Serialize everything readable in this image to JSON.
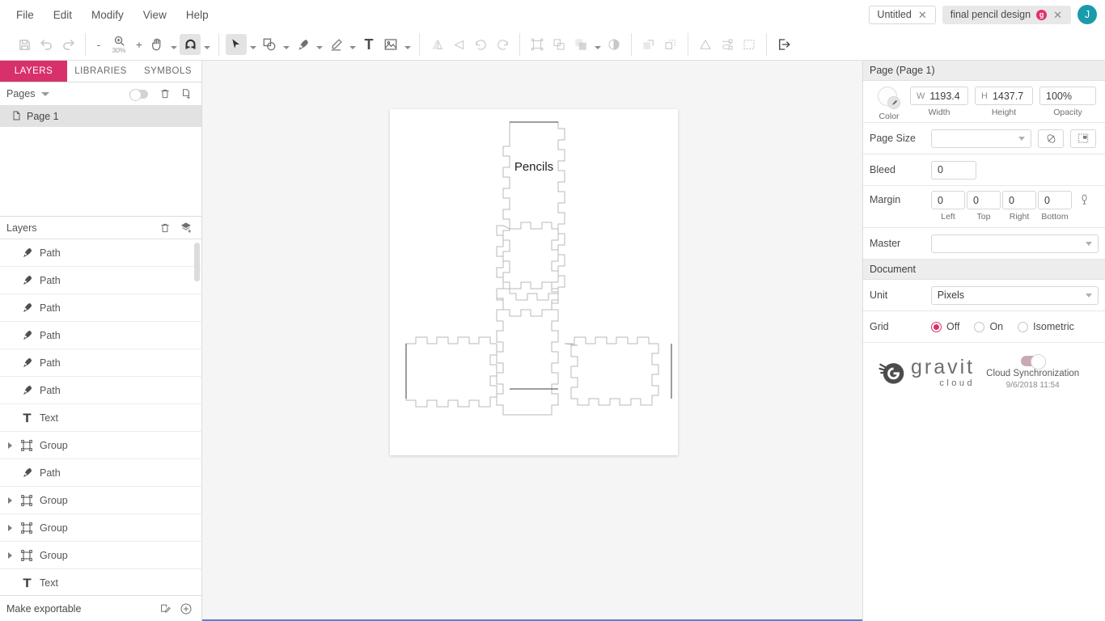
{
  "menubar": {
    "items": [
      "File",
      "Edit",
      "Modify",
      "View",
      "Help"
    ],
    "tabs": [
      {
        "title": "Untitled",
        "close": "✕",
        "badge": null,
        "active": false
      },
      {
        "title": "final pencil design",
        "close": "✕",
        "badge": "g",
        "active": true
      }
    ],
    "avatar_initial": "J"
  },
  "toolbar": {
    "zoom_minus": "-",
    "zoom_level": "30%",
    "zoom_plus": "+",
    "tools": {
      "save": "save-icon",
      "undo": "undo-icon",
      "redo": "redo-icon",
      "zoom": "zoom-icon",
      "hand": "hand-icon",
      "snap": "magnet-icon",
      "pointer": "pointer-icon",
      "shape": "shape-icon",
      "pen": "pen-icon",
      "pencil": "pencil-icon",
      "text": "T",
      "image": "image-icon",
      "flip_h": "flip-horizontal-icon",
      "flip_v": "flip-vertical-icon",
      "rotate_ccw": "rotate-ccw-icon",
      "rotate_cw": "rotate-cw-icon",
      "group": "group-icon",
      "ungroup": "ungroup-icon",
      "boolean": "boolean-icon",
      "mask": "mask-icon",
      "bring_forward": "bring-forward-icon",
      "send_backward": "send-backward-icon",
      "convert_path": "convert-to-path-icon",
      "path_ops": "path-ops-icon",
      "slice": "slice-icon",
      "export": "export-icon"
    }
  },
  "left_panel": {
    "tabs": [
      {
        "label": "LAYERS",
        "active": true
      },
      {
        "label": "LIBRARIES",
        "active": false
      },
      {
        "label": "SYMBOLS",
        "active": false
      }
    ],
    "pages_section": {
      "title": "Pages",
      "delete_icon": "trash-icon",
      "add_icon": "add-page-icon",
      "pages": [
        {
          "name": "Page 1",
          "selected": true
        }
      ]
    },
    "layers_section": {
      "title": "Layers",
      "delete_icon": "trash-icon",
      "add_icon": "add-layer-icon",
      "items": [
        {
          "label": "Path",
          "type": "path",
          "expandable": false
        },
        {
          "label": "Path",
          "type": "path",
          "expandable": false
        },
        {
          "label": "Path",
          "type": "path",
          "expandable": false
        },
        {
          "label": "Path",
          "type": "path",
          "expandable": false
        },
        {
          "label": "Path",
          "type": "path",
          "expandable": false
        },
        {
          "label": "Path",
          "type": "path",
          "expandable": false
        },
        {
          "label": "Text",
          "type": "text",
          "expandable": false
        },
        {
          "label": "Group",
          "type": "group",
          "expandable": true
        },
        {
          "label": "Path",
          "type": "path",
          "expandable": false
        },
        {
          "label": "Group",
          "type": "group",
          "expandable": true
        },
        {
          "label": "Group",
          "type": "group",
          "expandable": true
        },
        {
          "label": "Group",
          "type": "group",
          "expandable": true
        },
        {
          "label": "Text",
          "type": "text",
          "expandable": false
        }
      ]
    },
    "footer": {
      "label": "Make exportable",
      "edit_icon": "export-edit-icon",
      "add_icon": "plus-circle-icon"
    }
  },
  "canvas": {
    "artwork_label": "Pencils",
    "page_background": "#ffffff",
    "area_background": "#f5f5f5"
  },
  "right_panel": {
    "header": "Page (Page 1)",
    "color_label": "Color",
    "width": {
      "unit": "W",
      "value": "1193.4",
      "label": "Width"
    },
    "height": {
      "unit": "H",
      "value": "1437.7",
      "label": "Height"
    },
    "opacity": {
      "value": "100%",
      "label": "Opacity"
    },
    "page_size": {
      "label": "Page Size",
      "value": "",
      "orientation_icon": "orientation-icon",
      "fit_icon": "fit-to-selection-icon"
    },
    "bleed": {
      "label": "Bleed",
      "value": "0"
    },
    "margin": {
      "label": "Margin",
      "fields": [
        {
          "value": "0",
          "label": "Left"
        },
        {
          "value": "0",
          "label": "Top"
        },
        {
          "value": "0",
          "label": "Right"
        },
        {
          "value": "0",
          "label": "Bottom"
        }
      ],
      "link_icon": "link-icon"
    },
    "master": {
      "label": "Master",
      "value": ""
    },
    "document_header": "Document",
    "unit": {
      "label": "Unit",
      "value": "Pixels"
    },
    "grid": {
      "label": "Grid",
      "options": [
        {
          "label": "Off",
          "selected": true
        },
        {
          "label": "On",
          "selected": false
        },
        {
          "label": "Isometric",
          "selected": false
        }
      ]
    },
    "cloud": {
      "brand_main": "gravit",
      "brand_sub": "cloud",
      "sync_label": "Cloud Synchronization",
      "sync_date": "9/6/2018 11:54",
      "sync_enabled": true
    }
  },
  "colors": {
    "accent": "#d8306a",
    "avatar": "#1b9aaa",
    "badge": "#e0336a"
  }
}
